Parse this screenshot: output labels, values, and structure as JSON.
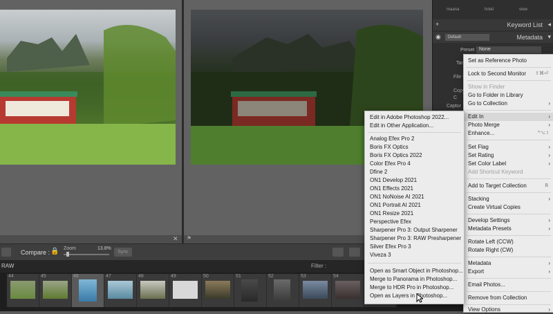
{
  "compare": {
    "label": "Compare :",
    "zoom_label": "Zoom",
    "zoom_value": "13.8%",
    "sync_label": "Sync"
  },
  "filmstrip": {
    "source": "RAW",
    "filter_label": "Filter :",
    "numbers": [
      "44",
      "45",
      "46",
      "47",
      "48",
      "49",
      "50",
      "51",
      "52",
      "53",
      "54",
      "55"
    ]
  },
  "right_panel": {
    "tags": [
      "maana",
      "hotel",
      "view"
    ],
    "keyword_list": "Keyword List",
    "metadata": "Metadata",
    "default_label": "Default",
    "preset_label": "Preset",
    "preset_value": "None",
    "partial_labels": [
      "Targ",
      "File N",
      "Copy",
      "C",
      "Captur"
    ]
  },
  "main_menu": {
    "items": [
      {
        "label": "Set as Reference Photo"
      },
      {
        "label": "Lock to Second Monitor",
        "shortcut": "⇧⌘⏎"
      },
      {
        "label": "Show in Finder",
        "disabled": true
      },
      {
        "label": "Go to Folder in Library"
      },
      {
        "label": "Go to Collection",
        "arrow": true
      },
      {
        "label": "Edit In",
        "arrow": true,
        "highlight": true
      },
      {
        "label": "Photo Merge",
        "arrow": true
      },
      {
        "label": "Enhance...",
        "shortcut": "^⌥ I"
      },
      {
        "label": "Set Flag",
        "arrow": true
      },
      {
        "label": "Set Rating",
        "arrow": true
      },
      {
        "label": "Set Color Label",
        "arrow": true
      },
      {
        "label": "Add Shortcut Keyword",
        "disabled": true
      },
      {
        "label": "Add to Target Collection",
        "shortcut": "B"
      },
      {
        "label": "Stacking",
        "arrow": true
      },
      {
        "label": "Create Virtual Copies"
      },
      {
        "label": "Develop Settings",
        "arrow": true
      },
      {
        "label": "Metadata Presets",
        "arrow": true
      },
      {
        "label": "Rotate Left (CCW)"
      },
      {
        "label": "Rotate Right (CW)"
      },
      {
        "label": "Metadata",
        "arrow": true
      },
      {
        "label": "Export",
        "arrow": true
      },
      {
        "label": "Email Photos..."
      },
      {
        "label": "Remove from Collection"
      },
      {
        "label": "View Options",
        "arrow": true
      }
    ]
  },
  "edit_in_menu": {
    "items": [
      {
        "label": "Edit in Adobe Photoshop 2022..."
      },
      {
        "label": "Edit in Other Application..."
      },
      {
        "label": "Analog Efex Pro 2"
      },
      {
        "label": "Boris FX Optics"
      },
      {
        "label": "Boris FX Optics 2022"
      },
      {
        "label": "Color Efex Pro 4"
      },
      {
        "label": "Dfine 2"
      },
      {
        "label": "ON1 Develop 2021"
      },
      {
        "label": "ON1 Effects 2021"
      },
      {
        "label": "ON1 NoNoise AI 2021"
      },
      {
        "label": "ON1 Portrait AI 2021"
      },
      {
        "label": "ON1 Resize 2021"
      },
      {
        "label": "Perspective Efex"
      },
      {
        "label": "Sharpener Pro 3: Output Sharpener"
      },
      {
        "label": "Sharpener Pro 3: RAW Presharpener"
      },
      {
        "label": "Silver Efex Pro 3"
      },
      {
        "label": "Viveza 3"
      },
      {
        "label": "Open as Smart Object in Photoshop..."
      },
      {
        "label": "Merge to Panorama in Photoshop..."
      },
      {
        "label": "Merge to HDR Pro in Photoshop..."
      },
      {
        "label": "Open as Layers in Photoshop..."
      }
    ]
  }
}
